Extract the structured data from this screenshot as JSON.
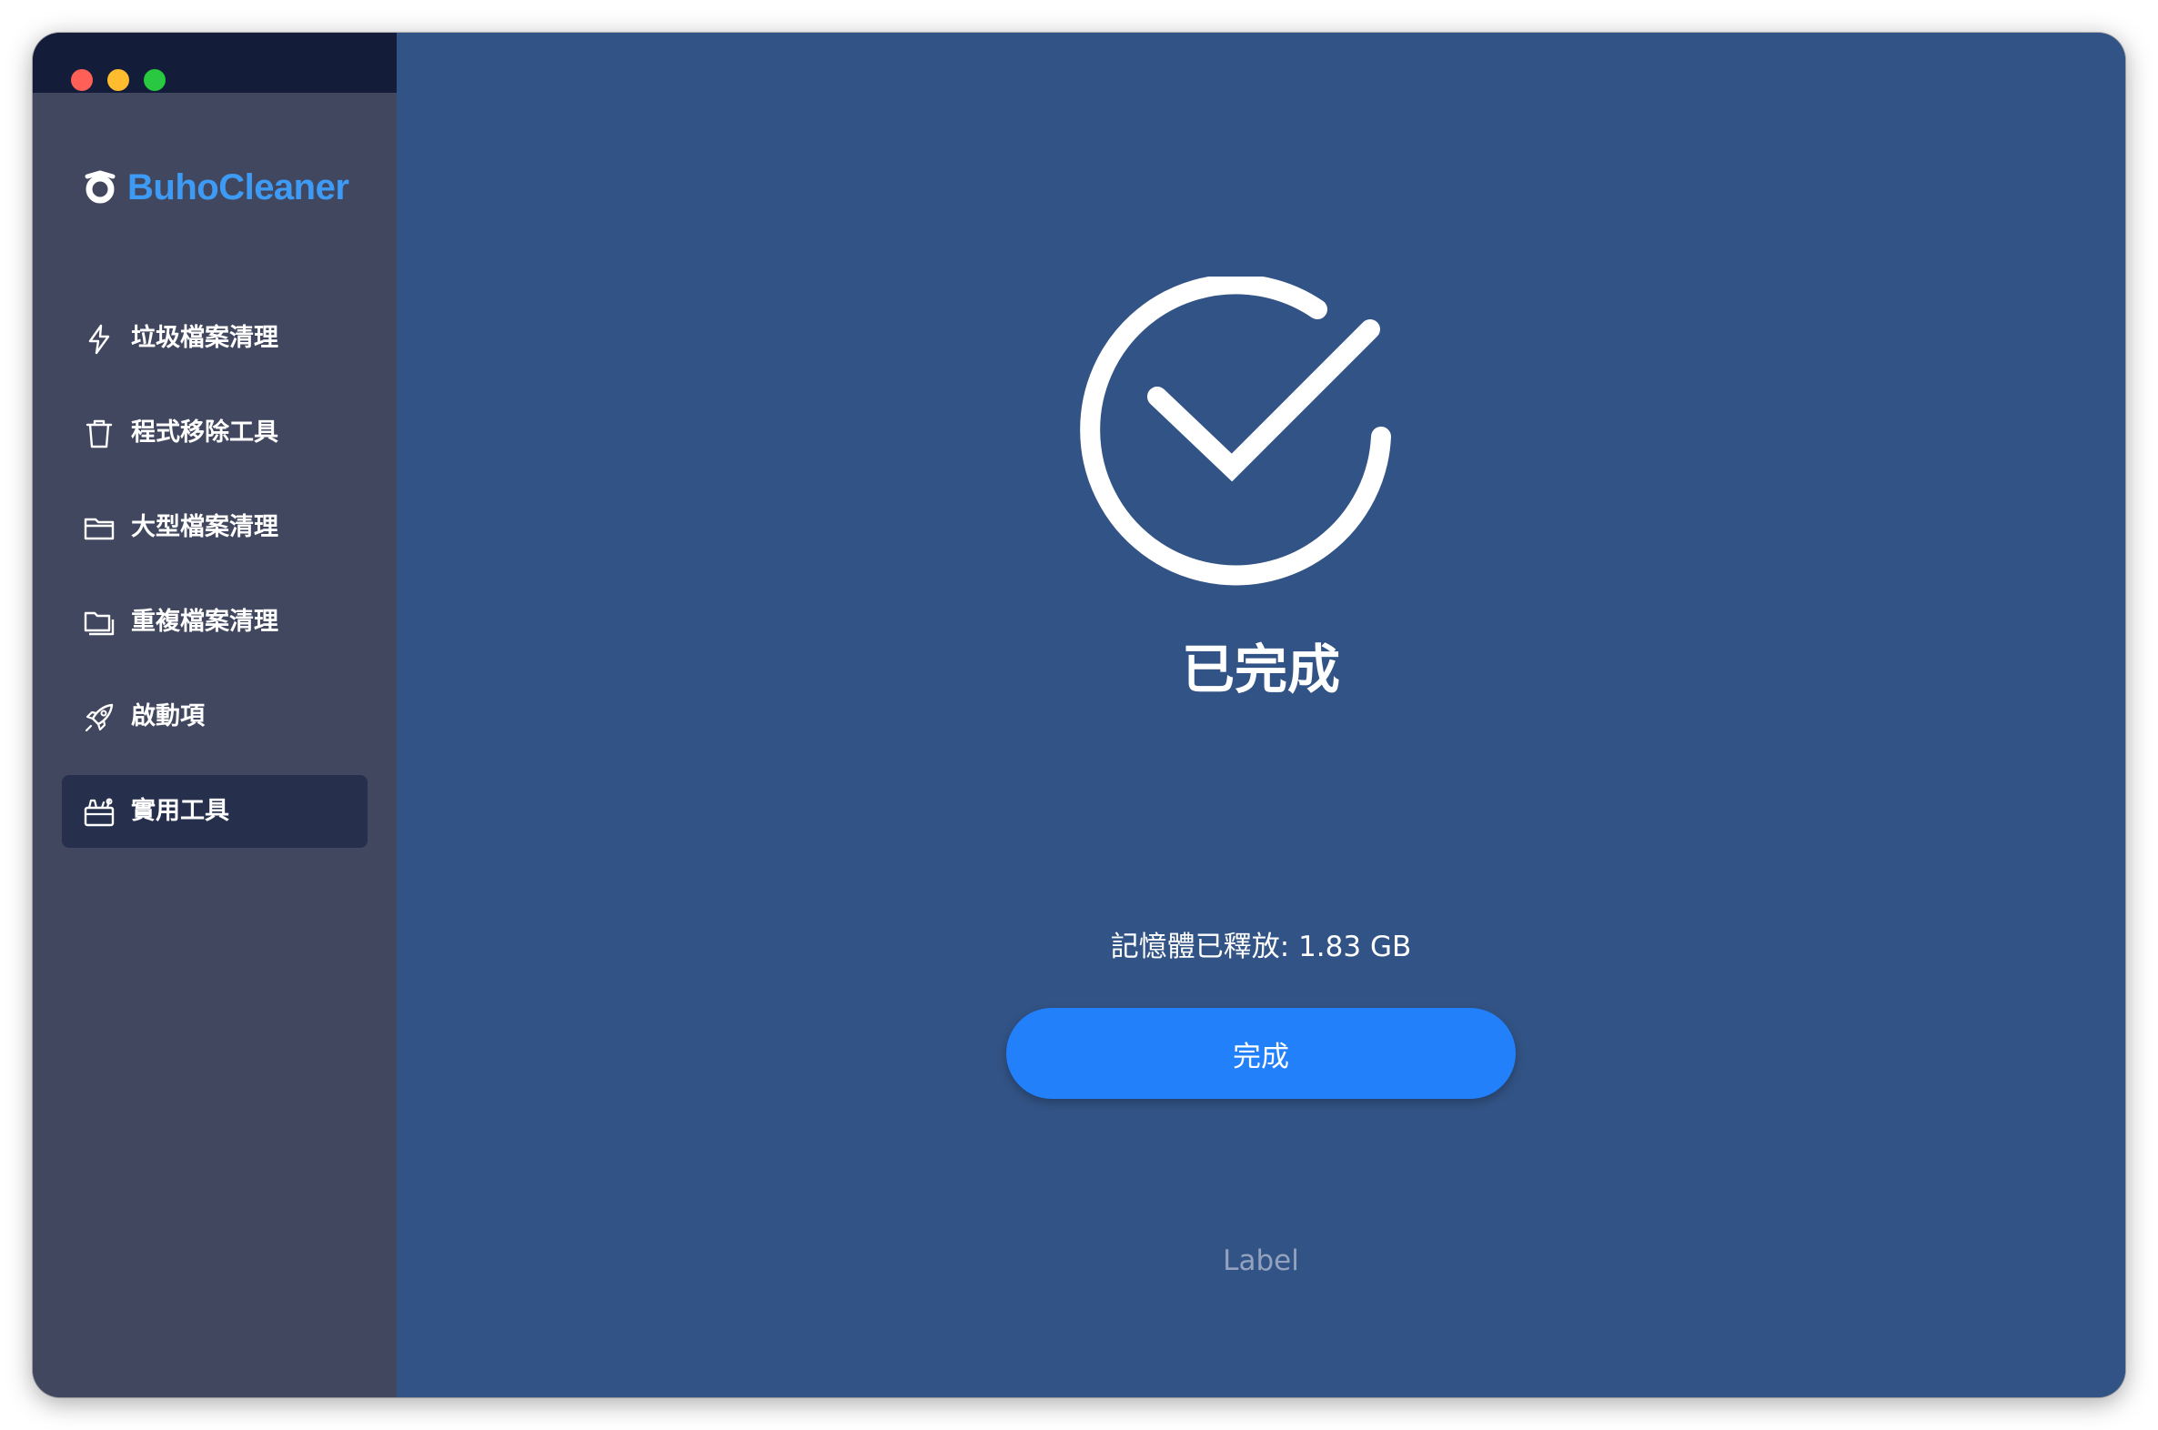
{
  "window": {
    "controls": [
      "close",
      "minimize",
      "zoom"
    ]
  },
  "brand": {
    "name": "BuhoCleaner",
    "color": "#3d9bf5",
    "logo_icon": "buho-logo-icon"
  },
  "sidebar": {
    "items": [
      {
        "label": "垃圾檔案清理",
        "icon": "lightning-icon",
        "active": false
      },
      {
        "label": "程式移除工具",
        "icon": "trash-icon",
        "active": false
      },
      {
        "label": "大型檔案清理",
        "icon": "folder-icon",
        "active": false
      },
      {
        "label": "重複檔案清理",
        "icon": "duplicate-folder-icon",
        "active": false
      },
      {
        "label": "啟動項",
        "icon": "rocket-icon",
        "active": false
      },
      {
        "label": "實用工具",
        "icon": "toolbox-icon",
        "active": true
      }
    ]
  },
  "main": {
    "status_icon": "checkmark-circle-icon",
    "title": "已完成",
    "memory_text": "記憶體已釋放: 1.83 GB",
    "done_button": "完成",
    "footer_label": "Label"
  },
  "colors": {
    "sidebar_bg": "#41475f",
    "titlebar_bg": "#131d3a",
    "main_bg": "#325385",
    "active_item_bg": "#26304d",
    "button_bg": "#2280fb",
    "footer_label": "#93a3bf"
  }
}
